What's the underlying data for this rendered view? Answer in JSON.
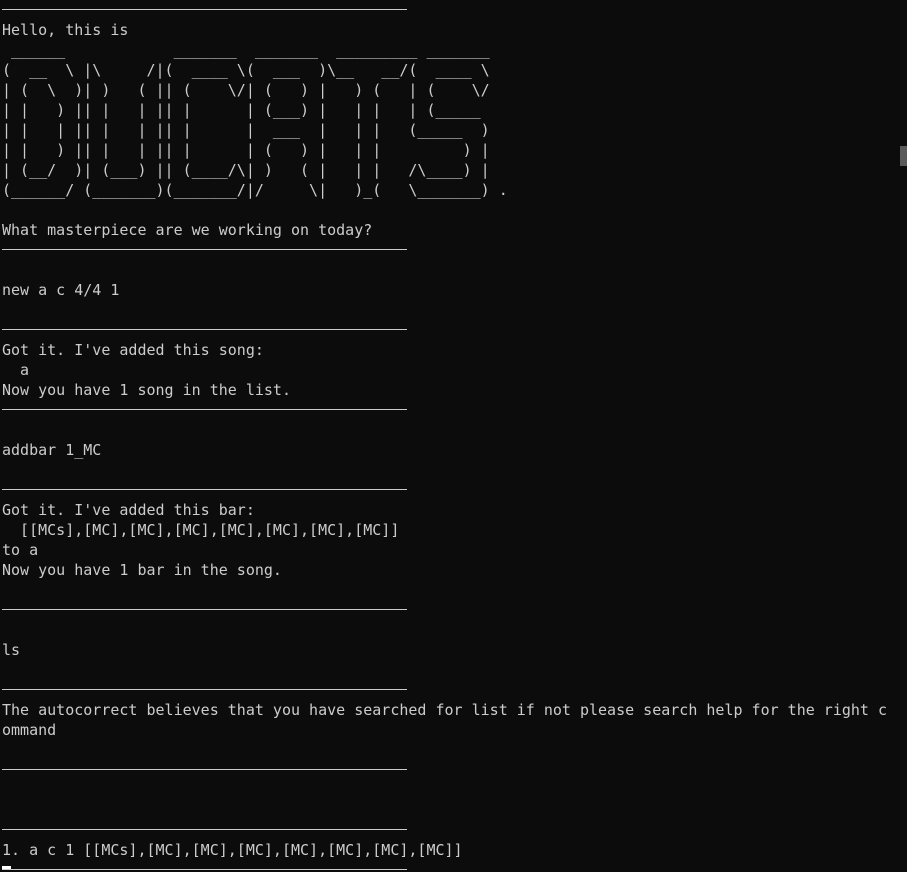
{
  "terminal": {
    "greeting": "Hello, this is",
    "logo_lines": [
      " ______            _______  _______  _________ _______ ",
      "(  __  \\ |\\     /|(  ____ \\(  ___  )\\__   __/(  ____ \\",
      "| (  \\  )| )   ( || (    \\/| (   ) |   ) (   | (    \\/",
      "| |   ) || |   | || |      | (___) |   | |   | (_____ ",
      "| |   | || |   | || |      |  ___  |   | |   (_____  )",
      "| |   ) || |   | || |      | (   ) |   | |         ) |",
      "| (__/  )| (___) || (____/\\| )   ( |   | |   /\\____) |",
      "(______/ (_______)(_______/|/     \\|   )_(   \\_______) ."
    ],
    "prompt_question": "What masterpiece are we working on today?",
    "cmd_new": "new a c 4/4 1",
    "song_added_line1": "Got it. I've added this song:",
    "song_added_line2": "  a",
    "song_added_line3": "Now you have 1 song in the list.",
    "cmd_addbar": "addbar 1_MC",
    "bar_added_line1": "Got it. I've added this bar:",
    "bar_added_line2": "  [[MCs],[MC],[MC],[MC],[MC],[MC],[MC],[MC]]",
    "bar_added_line3": "to a",
    "bar_added_line4": "Now you have 1 bar in the song.",
    "cmd_ls": "ls",
    "autocorrect_msg": "The autocorrect believes that you have searched for list if not please search help for the right command",
    "list_item": "1. a c 1 [[MCs],[MC],[MC],[MC],[MC],[MC],[MC],[MC]]"
  }
}
